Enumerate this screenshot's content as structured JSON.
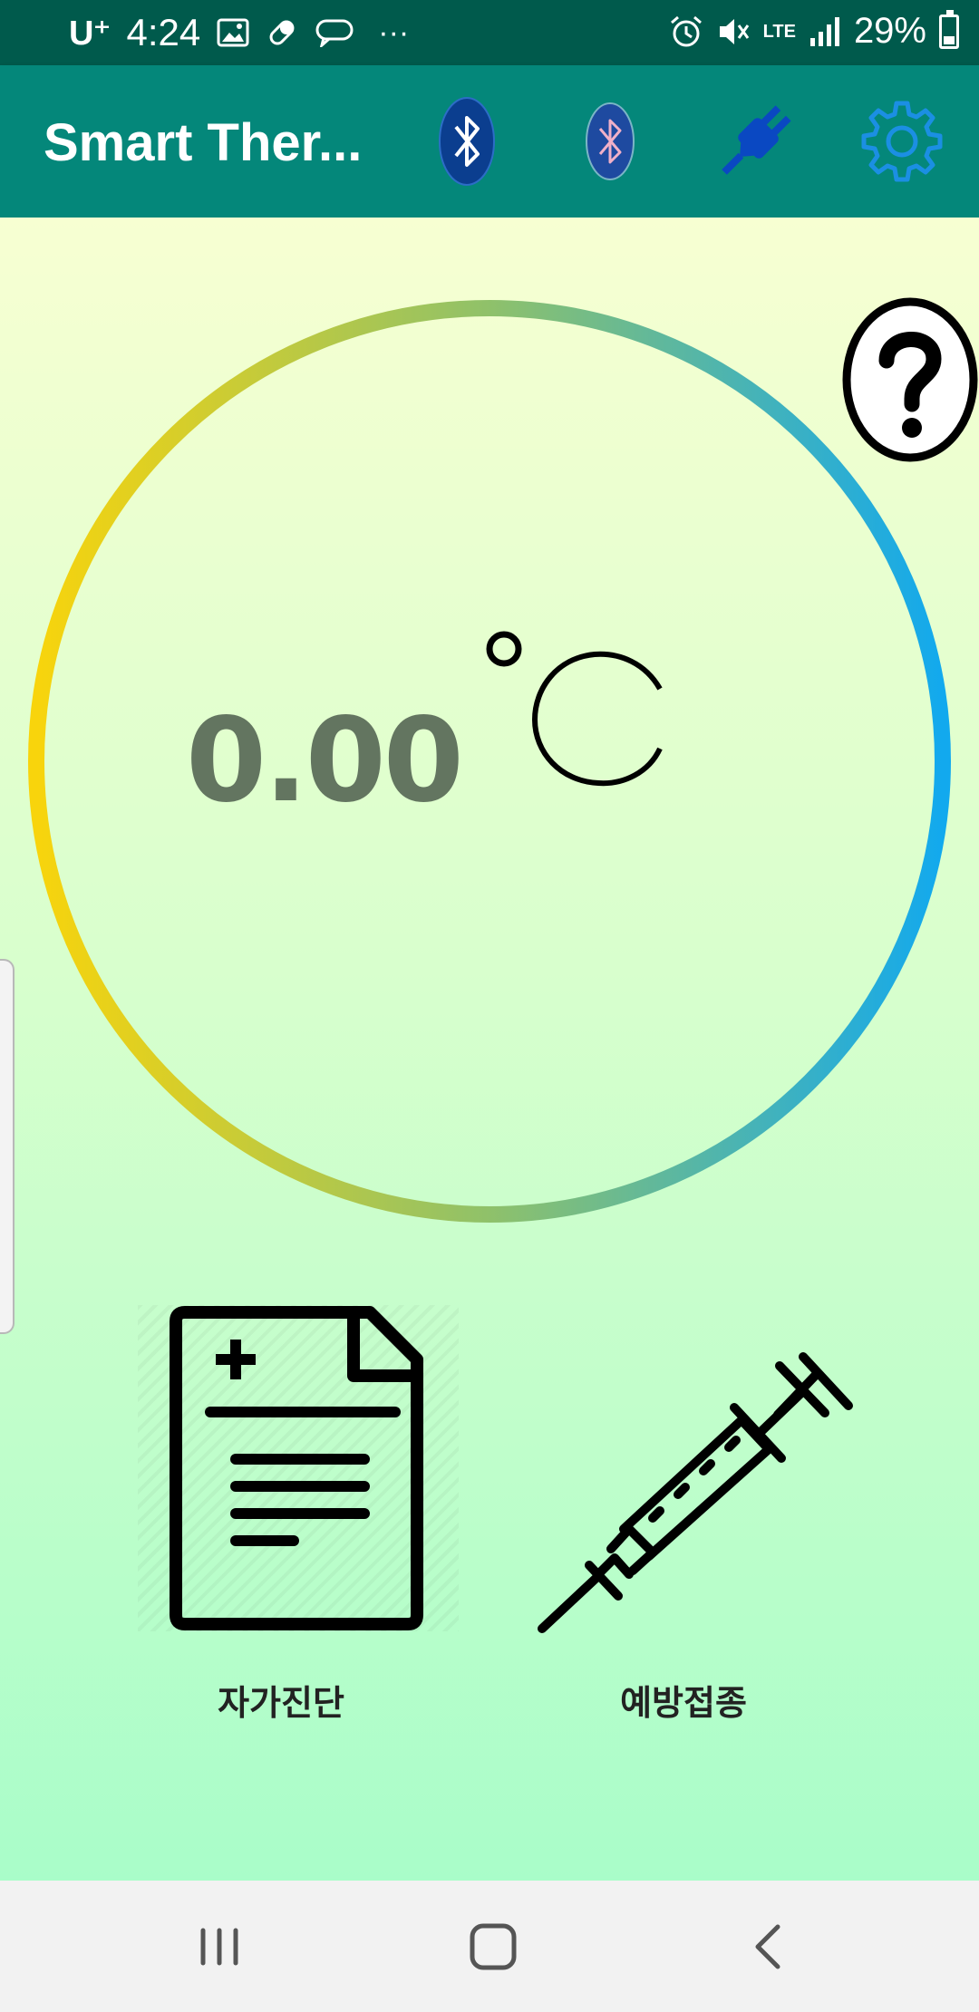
{
  "status_bar": {
    "carrier": "U⁺",
    "time": "4:24",
    "more": "···",
    "network": "LTE",
    "battery": "29%",
    "battery_level": 0.29,
    "icons": [
      "gallery-icon",
      "pill-icon",
      "chat-icon",
      "alarm-icon",
      "mute-icon",
      "signal-icon",
      "battery-icon"
    ]
  },
  "app_bar": {
    "title": "Smart Ther...",
    "actions": [
      "bluetooth-icon",
      "bluetooth-icon",
      "plug-icon",
      "gear-icon"
    ]
  },
  "thermometer": {
    "value": "0.00",
    "unit": "°C",
    "help": "?",
    "ring_colors": [
      "#f8d40c",
      "#8fc16a",
      "#12a9ee"
    ]
  },
  "actions": [
    {
      "label": "자가진단",
      "icon": "medical-document-icon"
    },
    {
      "label": "예방접종",
      "icon": "syringe-icon"
    }
  ],
  "nav_bar": {
    "buttons": [
      "recent-apps-icon",
      "home-icon",
      "back-icon"
    ]
  },
  "colors": {
    "status_bar": "#005a4c",
    "app_bar": "#04877a",
    "bt_fill": "#0b3e8f",
    "plug": "#0a48c2",
    "gear": "#1b8fe3",
    "temp_text": "#637560"
  }
}
